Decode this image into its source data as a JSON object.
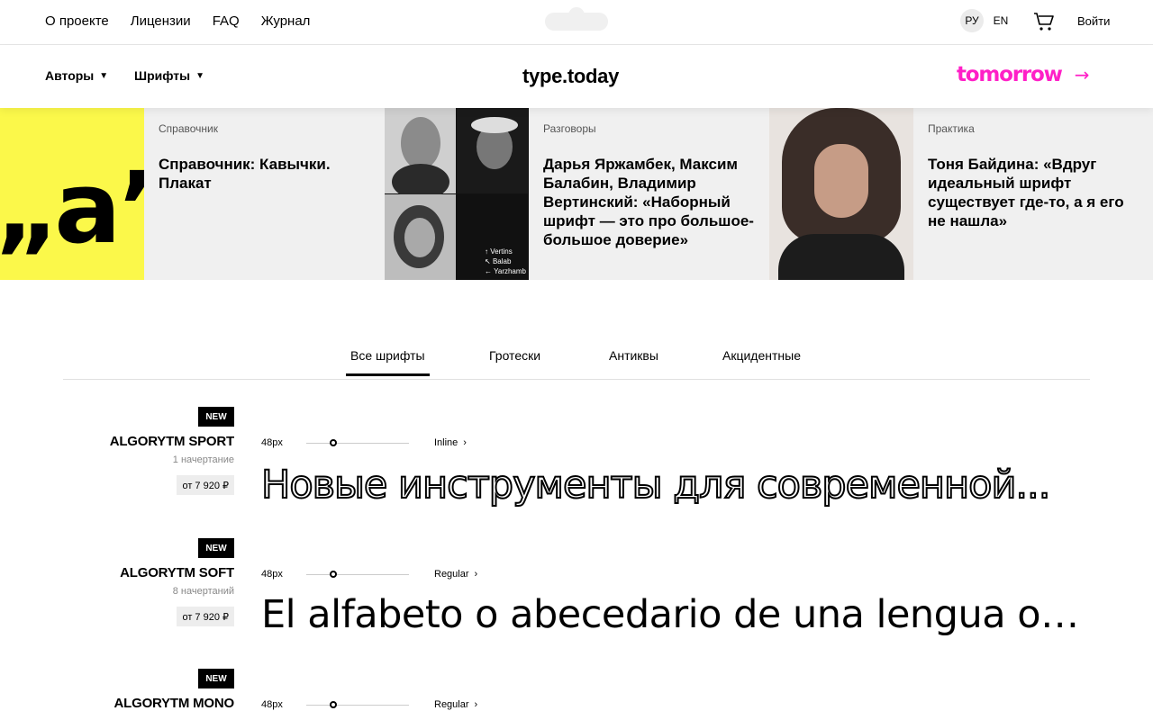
{
  "topnav": {
    "links": [
      "О проекте",
      "Лицензии",
      "FAQ",
      "Журнал"
    ],
    "lang_active": "РУ",
    "lang_other": "EN",
    "login": "Войти"
  },
  "secnav": {
    "authors": "Авторы",
    "fonts": "Шрифты",
    "brand": "type.today",
    "tomorrow": "tomorrow",
    "arrow": "→",
    "chevron": "⌄"
  },
  "features": [
    {
      "category": "Справочник",
      "title": "Справочник: Кавычки. Плакат",
      "image_text": "„a”"
    },
    {
      "category": "Разговоры",
      "title": "Дарья Яржамбек, Максим Балабин, Владимир Вертинский: «Наборный шрифт — это про большое-большое доверие»",
      "image_labels": [
        "↑ Vertins",
        "↖ Balab",
        "← Yarzhamb"
      ]
    },
    {
      "category": "Практика",
      "title": "Тоня Байдина: «Вдруг идеальный шрифт существует где-то, а я его не нашла»"
    }
  ],
  "tabs": [
    "Все шрифты",
    "Гротески",
    "Антиквы",
    "Акцидентные"
  ],
  "fonts": [
    {
      "badge": "NEW",
      "name": "ALGORYTM SPORT",
      "count": "1 начертание",
      "price": "от 7 920 ₽",
      "size": "48px",
      "style": "Inline",
      "sample": "Новые инструменты для современной..."
    },
    {
      "badge": "NEW",
      "name": "ALGORYTM SOFT",
      "count": "8 начертаний",
      "price": "от 7 920 ₽",
      "size": "48px",
      "style": "Regular",
      "sample": "El alfabeto o abecedario de una lengua o i..."
    },
    {
      "badge": "NEW",
      "name": "ALGORYTM MONO",
      "size": "48px",
      "style": "Regular"
    }
  ],
  "colors": {
    "accent": "#ff1fc7",
    "yellow": "#fbf84a",
    "card_bg": "#f0f0f0"
  }
}
